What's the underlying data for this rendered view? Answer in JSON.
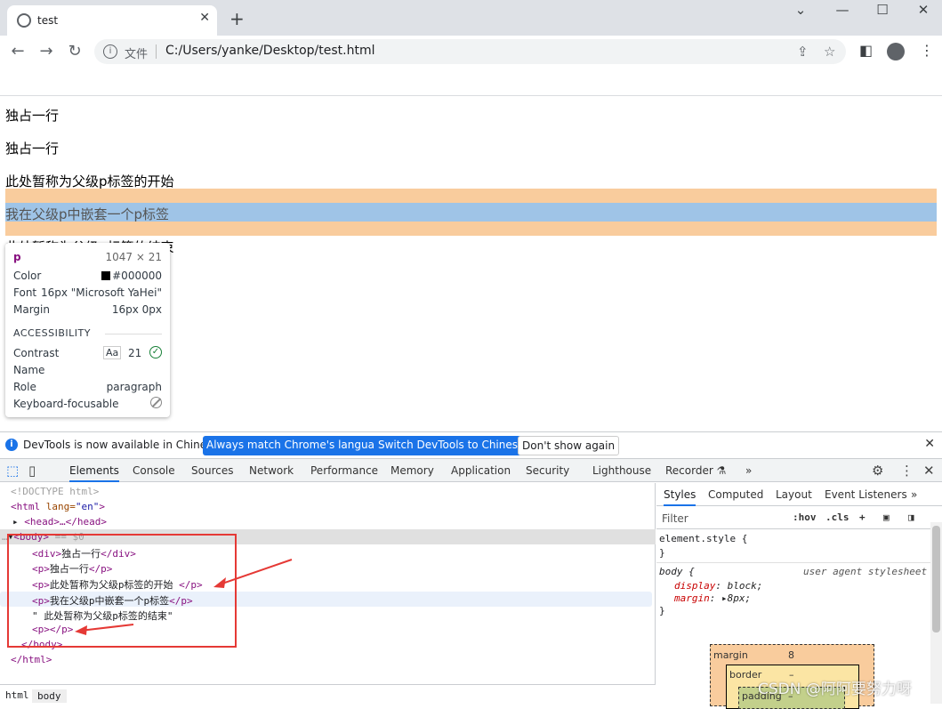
{
  "browser": {
    "tab_title": "test",
    "tab_close": "✕",
    "new_tab": "+",
    "window_controls": [
      "⌄",
      "—",
      "☐",
      "✕"
    ],
    "address_prefix": "文件",
    "url": "C:/Users/yanke/Desktop/test.html"
  },
  "page": {
    "lines": [
      "独占一行",
      "独占一行",
      "此处暂称为父级p标签的开始",
      "我在父级p中嵌套一个p标签",
      "此处暂称为父级p标签的结束"
    ]
  },
  "tooltip": {
    "tag": "p",
    "size": "1047 × 21",
    "rows": [
      {
        "label": "Color",
        "value": "#000000"
      },
      {
        "label": "Font",
        "value": "16px \"Microsoft YaHei\""
      },
      {
        "label": "Margin",
        "value": "16px 0px"
      }
    ],
    "accessibility_title": "ACCESSIBILITY",
    "contrast_label": "Contrast",
    "contrast_aa": "Aa",
    "contrast_value": "21",
    "name_label": "Name",
    "role_label": "Role",
    "role_value": "paragraph",
    "keyboard_label": "Keyboard-focusable"
  },
  "banner": {
    "message": "DevTools is now available in Chinese!",
    "btn_match": "Always match Chrome's language",
    "btn_switch": "Switch DevTools to Chinese",
    "btn_dont": "Don't show again"
  },
  "devtools_tabs": [
    "Elements",
    "Console",
    "Sources",
    "Network",
    "Performance",
    "Memory",
    "Application",
    "Security",
    "Lighthouse",
    "Recorder"
  ],
  "devtools_more": "»",
  "elements": {
    "doctype": "<!DOCTYPE html>",
    "html_open_tag": "<html",
    "html_attr": " lang=",
    "html_attr_val": "\"en\"",
    "html_close_br": ">",
    "head": "<head>…</head>",
    "body_open": "<body>",
    "body_marker": " == $0",
    "div_open": "<div>",
    "div_text": "独占一行",
    "div_close": "</div>",
    "p1_text": "独占一行",
    "p2_text": "此处暂称为父级p标签的开始 ",
    "p3_text": "我在父级p中嵌套一个p标签",
    "text_node": "\" 此处暂称为父级p标签的结束\"",
    "p_open": "<p>",
    "p_close": "</p>",
    "body_close": "</body>",
    "html_close": "</html>"
  },
  "breadcrumbs": [
    "html",
    "body"
  ],
  "styles": {
    "tabs": [
      "Styles",
      "Computed",
      "Layout",
      "Event Listeners"
    ],
    "filter_placeholder": "Filter",
    "hov": ":hov",
    "cls": ".cls",
    "element_style": "element.style {",
    "close_brace": "}",
    "body_selector": "body {",
    "ua_label": "user agent stylesheet",
    "decl1_prop": "display",
    "decl1_val": "block;",
    "decl2_prop": "margin",
    "decl2_val": "8px;",
    "box_margin_label": "margin",
    "box_margin_value": "8",
    "box_border_label": "border",
    "box_border_value": "–",
    "box_padding_label": "padding",
    "box_padding_value": "–"
  },
  "watermark": "CSDN @阿阿要努力呀",
  "colors": {
    "margin_highlight": "#f9cc9d",
    "content_highlight": "#9fc4e7",
    "annotation_red": "#e53935",
    "accent_blue": "#1a73e8"
  }
}
